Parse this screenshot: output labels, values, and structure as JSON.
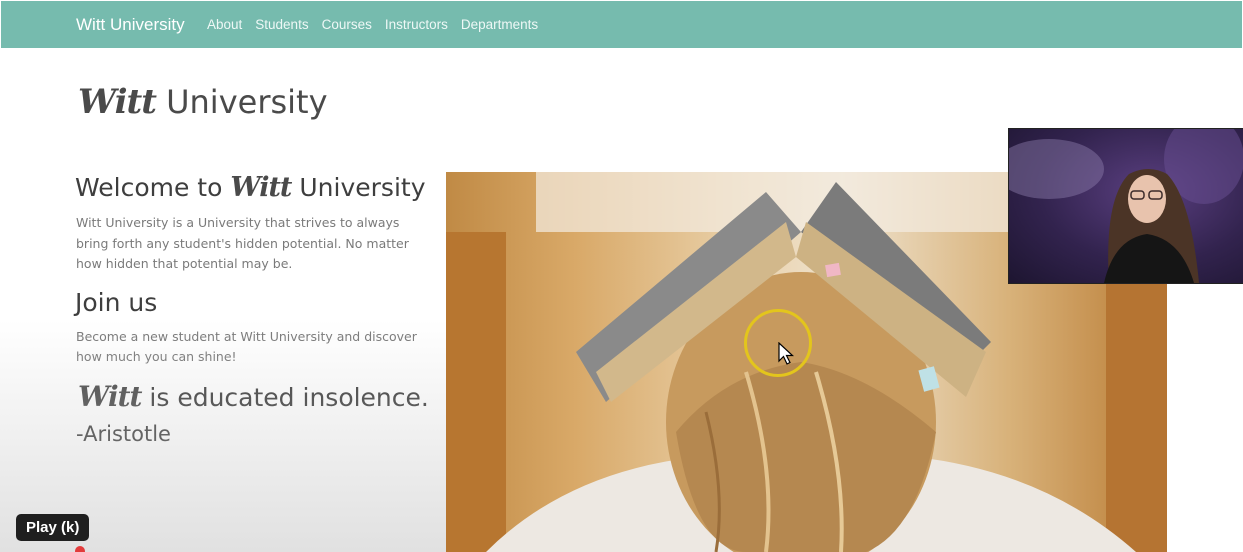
{
  "navbar": {
    "brand": "Witt University",
    "links": [
      "About",
      "Students",
      "Courses",
      "Instructors",
      "Departments"
    ],
    "background": "#76bbae"
  },
  "header": {
    "title_script": "Witt",
    "title_rest": "University"
  },
  "welcome": {
    "prefix": "Welcome to",
    "script": "Witt",
    "suffix": "University",
    "description": "Witt University is a University that strives to always bring forth any student's hidden potential. No matter how hidden that potential may be."
  },
  "join": {
    "heading": "Join us",
    "text": "Become a new student at Witt University and discover how much you can shine!"
  },
  "quote": {
    "script": "Witt",
    "text": "is educated insolence.",
    "author": "-Aristotle"
  },
  "player": {
    "play_tooltip": "Play (k)"
  },
  "icons": {
    "cursor": "cursor-arrow-icon",
    "hero": "student-with-book-on-head-image",
    "webcam": "presenter-webcam-feed"
  }
}
